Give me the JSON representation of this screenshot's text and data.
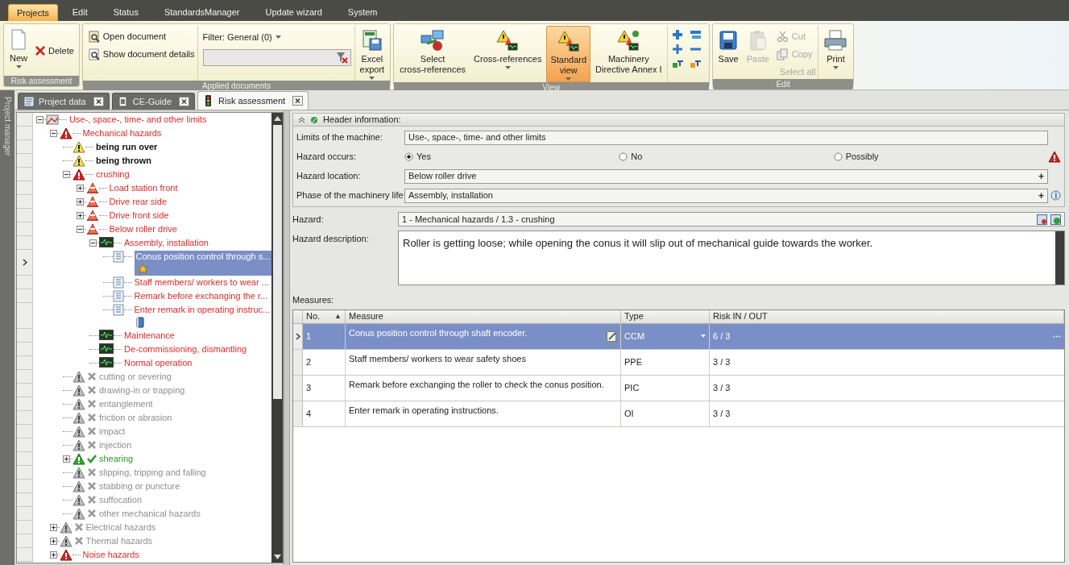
{
  "menu": [
    {
      "label": "Projects",
      "selected": true
    },
    {
      "label": "Edit",
      "selected": false
    },
    {
      "label": "Status",
      "selected": false
    },
    {
      "label": "StandardsManager",
      "selected": false
    },
    {
      "label": "Update wizard",
      "selected": false
    },
    {
      "label": "System",
      "selected": false
    }
  ],
  "ribbon": {
    "groups": [
      {
        "caption": "Risk assessment",
        "items": [
          {
            "kind": "large",
            "label": "New",
            "dropdown": true
          },
          {
            "kind": "small",
            "label": "Delete"
          }
        ]
      },
      {
        "caption": "Applied documents",
        "items": [
          {
            "kind": "stack",
            "entries": [
              {
                "label": "Open document"
              },
              {
                "label": "Show document details"
              }
            ]
          },
          {
            "kind": "filter",
            "label": "Filter: General (0)"
          },
          {
            "kind": "large",
            "label": "Excel\nexport",
            "dropdown": true
          }
        ]
      },
      {
        "caption": "View",
        "items": [
          {
            "kind": "large",
            "label": "Select\ncross-references",
            "selected": false
          },
          {
            "kind": "large",
            "label": "Cross-references",
            "dropdown": true,
            "selected": false
          },
          {
            "kind": "large",
            "label": "Standard\nview",
            "dropdown": true,
            "selected": true
          },
          {
            "kind": "large",
            "label": "Machinery\nDirective Annex I",
            "selected": false
          },
          {
            "kind": "icons"
          }
        ]
      },
      {
        "caption": "Edit",
        "items": [
          {
            "kind": "large",
            "label": "Save",
            "disabled": false
          },
          {
            "kind": "large",
            "label": "Paste",
            "disabled": true
          },
          {
            "kind": "stack",
            "entries": [
              {
                "label": "Cut",
                "disabled": true
              },
              {
                "label": "Copy",
                "disabled": true
              },
              {
                "label": "Select all",
                "disabled": true
              }
            ]
          },
          {
            "kind": "large",
            "label": "Print",
            "dropdown": true,
            "disabled": false
          }
        ]
      }
    ]
  },
  "doc_tabs": [
    {
      "label": "Project data",
      "selected": false
    },
    {
      "label": "CE-Guide",
      "selected": false
    },
    {
      "label": "Risk assessment",
      "selected": true
    }
  ],
  "side_strip": {
    "title": "Project manager"
  },
  "tree": {
    "items": [
      {
        "kind": "limits",
        "text": "Use-, space-, time- and other limits",
        "expanded": true,
        "selected": false,
        "children": [
          {
            "kind": "hazard",
            "text": "Mechanical hazards",
            "expanded": true,
            "selected": false,
            "children": [
              {
                "kind": "warning",
                "text": "being run over",
                "selected": false
              },
              {
                "kind": "warning",
                "text": "being thrown",
                "selected": false
              },
              {
                "kind": "hazard",
                "text": "crushing",
                "expanded": true,
                "selected": false,
                "children": [
                  {
                    "kind": "location",
                    "text": "Load station front",
                    "expanded": false,
                    "selected": false
                  },
                  {
                    "kind": "location",
                    "text": "Drive rear side",
                    "expanded": false,
                    "selected": false
                  },
                  {
                    "kind": "location",
                    "text": "Drive front side",
                    "expanded": false,
                    "selected": false
                  },
                  {
                    "kind": "location",
                    "text": "Below roller drive",
                    "expanded": true,
                    "selected": false,
                    "children": [
                      {
                        "kind": "phase",
                        "text": "Assembly,  installation",
                        "expanded": true,
                        "selected": false,
                        "children": [
                          {
                            "kind": "measure",
                            "text": "Conus position control through s...",
                            "selected": true,
                            "starred": true
                          },
                          {
                            "kind": "measure",
                            "text": "Staff members/ workers to wear ...",
                            "selected": false
                          },
                          {
                            "kind": "measure",
                            "text": "Remark before exchanging the r...",
                            "selected": false
                          },
                          {
                            "kind": "measure",
                            "text": "Enter remark in operating instruc...",
                            "selected": false,
                            "manual": true
                          }
                        ]
                      },
                      {
                        "kind": "phase",
                        "text": "Maintenance",
                        "selected": false
                      },
                      {
                        "kind": "phase",
                        "text": "De-commissioning, dismantling",
                        "selected": false
                      },
                      {
                        "kind": "phase",
                        "text": "Normal operation",
                        "selected": false
                      }
                    ]
                  }
                ]
              },
              {
                "kind": "inactive",
                "text": "cutting or severing",
                "selected": false
              },
              {
                "kind": "inactive",
                "text": "drawing-in or trapping",
                "selected": false
              },
              {
                "kind": "inactive",
                "text": "entanglement",
                "selected": false
              },
              {
                "kind": "inactive",
                "text": "friction or abrasion",
                "selected": false
              },
              {
                "kind": "inactive",
                "text": "impact",
                "selected": false
              },
              {
                "kind": "inactive",
                "text": "injection",
                "selected": false
              },
              {
                "kind": "done",
                "text": "shearing",
                "expanded": false,
                "selected": false
              },
              {
                "kind": "inactive",
                "text": "slipping, tripping and falling",
                "selected": false
              },
              {
                "kind": "inactive",
                "text": "stabbing or puncture",
                "selected": false
              },
              {
                "kind": "inactive",
                "text": "suffocation",
                "selected": false
              },
              {
                "kind": "inactive",
                "text": "other mechanical hazards",
                "selected": false
              }
            ]
          },
          {
            "kind": "inactive",
            "text": "Electrical hazards",
            "expanded": false,
            "selected": false
          },
          {
            "kind": "inactive",
            "text": "Thermal hazards",
            "expanded": false,
            "selected": false
          },
          {
            "kind": "hazard",
            "text": "Noise hazards",
            "expanded": false,
            "selected": false
          }
        ]
      }
    ]
  },
  "header": {
    "title": "Header information:",
    "fields": [
      {
        "kind": "text",
        "label": "Limits of the machine:",
        "value": "Use-, space-, time- and other limits"
      },
      {
        "kind": "radio",
        "label": "Hazard occurs:",
        "warning": true,
        "options": [
          {
            "label": "Yes",
            "selected": true
          },
          {
            "label": "No",
            "selected": false
          },
          {
            "label": "Possibly",
            "selected": false
          }
        ]
      },
      {
        "kind": "text",
        "label": "Hazard location:",
        "value": "Below roller drive",
        "action": "+"
      },
      {
        "kind": "text",
        "label": "Phase of the machinery life:",
        "value": "Assembly,  installation",
        "action": "+",
        "info": true
      }
    ]
  },
  "hazard": {
    "label": "Hazard:",
    "value": "1 - Mechanical hazards / 1.3 - crushing"
  },
  "description": {
    "label": "Hazard description:",
    "value": "Roller is getting loose; while opening the conus it will slip out of mechanical guide  towards the worker."
  },
  "measures": {
    "label": "Measures:",
    "columns": [
      {
        "label": "No.",
        "sort": "▲"
      },
      {
        "label": "Measure"
      },
      {
        "label": "Type"
      },
      {
        "label": "Risk IN / OUT"
      }
    ],
    "rows": [
      {
        "no": "1",
        "measure": "Conus position control through shaft encoder.",
        "type": "CCM",
        "risk": "6 / 3",
        "selected": true
      },
      {
        "no": "2",
        "measure": "Staff members/ workers to wear safety shoes",
        "type": "PPE",
        "risk": "3 / 3",
        "selected": false
      },
      {
        "no": "3",
        "measure": "Remark before exchanging the roller to check the conus position.",
        "type": "PIC",
        "risk": "3 / 3",
        "selected": false
      },
      {
        "no": "4",
        "measure": "Enter remark in operating instructions.",
        "type": "OI",
        "risk": "3 / 3",
        "selected": false
      }
    ]
  }
}
